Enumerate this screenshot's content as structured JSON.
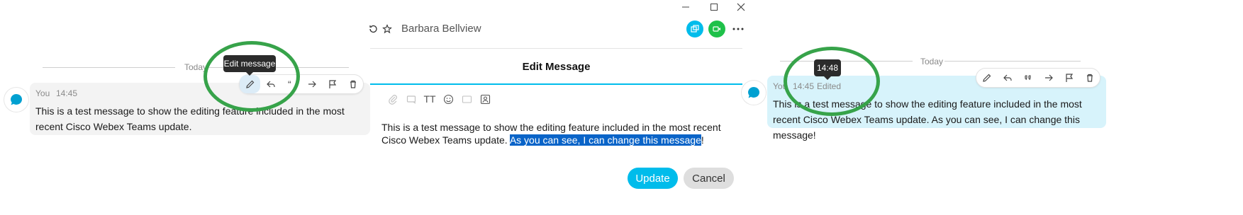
{
  "left_panel": {
    "day_label": "Today",
    "sender": "You",
    "time": "14:45",
    "message": "This is a test message to show the editing feature included in the most recent Cisco Webex Teams update.",
    "tooltip": "Edit message"
  },
  "middle_panel": {
    "contact_name": "Barbara Bellview",
    "dialog_title": "Edit Message",
    "text_before_selection": "This is a test message to show the editing feature included in the most recent Cisco Webex Teams update. ",
    "selected_text": "As you can see, I can change this message",
    "text_after_selection": "!",
    "update_label": "Update",
    "cancel_label": "Cancel",
    "format_icon_label": "TT"
  },
  "right_panel": {
    "day_label": "Today",
    "sender": "You",
    "time": "14:45",
    "edited_label": "Edited",
    "tooltip_time": "14:48",
    "message": "This is a test message to show the editing feature included in the most recent Cisco Webex Teams update. As you can see, I can change this message!"
  },
  "colors": {
    "accent_cyan": "#00bceb",
    "video_green": "#1fc14a",
    "highlight_ring": "#37a34a",
    "selection_blue": "#0a64c8",
    "edited_bubble": "#d7f3fb",
    "plain_bubble": "#f3f3f3"
  }
}
